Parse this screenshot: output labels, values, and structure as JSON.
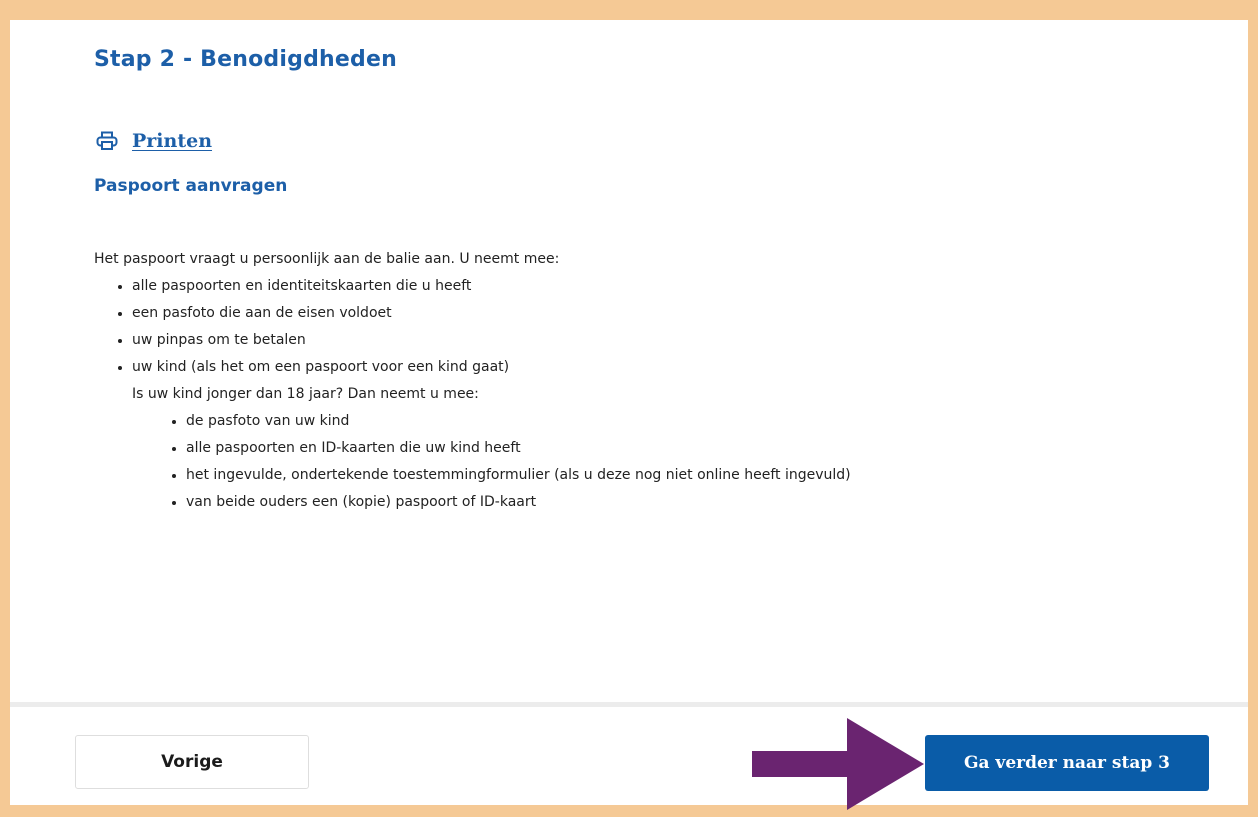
{
  "page": {
    "step_title": "Stap 2 - Benodigdheden",
    "print_label": "Printen",
    "print_icon": "printer-icon",
    "section_title": "Paspoort aanvragen"
  },
  "content": {
    "intro": "Het paspoort vraagt u persoonlijk aan de balie aan. U neemt mee:",
    "items": [
      "alle paspoorten en identiteitskaarten die u heeft",
      "een pasfoto die aan de eisen voldoet",
      "uw pinpas om te betalen",
      "uw kind (als het om een paspoort voor een kind gaat)"
    ],
    "child_note": "Is uw kind jonger dan 18 jaar? Dan neemt u mee:",
    "child_items": [
      "de pasfoto van uw kind",
      "alle paspoorten en ID-kaarten die uw kind heeft",
      "het ingevulde, ondertekende toestemmingformulier (als u deze nog niet online heeft ingevuld)",
      "van beide ouders een (kopie) paspoort of ID-kaart"
    ]
  },
  "footer": {
    "back_label": "Vorige",
    "next_label": "Ga verder naar stap 3"
  },
  "colors": {
    "frame": "#f5c995",
    "heading": "#1d5fa8",
    "primary_button": "#0a5ca8",
    "annotation_arrow": "#6a2470"
  }
}
